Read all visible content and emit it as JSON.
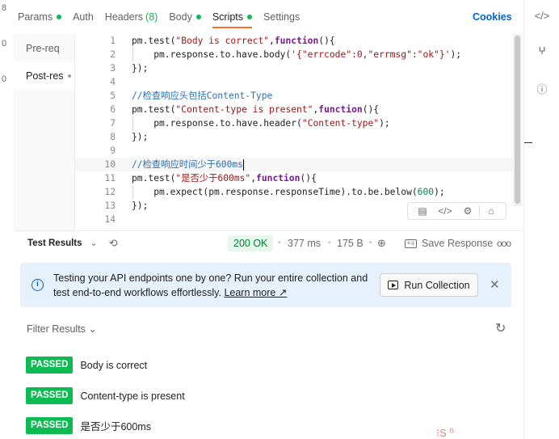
{
  "tabs": [
    {
      "label": "Params",
      "dot": true
    },
    {
      "label": "Auth"
    },
    {
      "label": "Headers",
      "count": "(8)"
    },
    {
      "label": "Body",
      "dot": true
    },
    {
      "label": "Scripts",
      "dot": true,
      "active": true
    },
    {
      "label": "Settings"
    }
  ],
  "cookies_label": "Cookies",
  "script_sidebar": [
    "Pre-req",
    "Post-res"
  ],
  "editor": {
    "lines": [
      {
        "n": "1",
        "code": "pm.test(\"Body is correct\",function(){"
      },
      {
        "n": "2",
        "code": "    pm.response.to.have.body('{\"errcode\":0,\"errmsg\":\"ok\"}');"
      },
      {
        "n": "3",
        "code": "});"
      },
      {
        "n": "4",
        "code": ""
      },
      {
        "n": "5",
        "code": "//检查响应头包括Content-Type"
      },
      {
        "n": "6",
        "code": "pm.test(\"Content-type is present\",function(){"
      },
      {
        "n": "7",
        "code": "    pm.response.to.have.header(\"Content-type\");"
      },
      {
        "n": "8",
        "code": "});"
      },
      {
        "n": "9",
        "code": ""
      },
      {
        "n": "10",
        "code": "//检查响应时间少于600ms"
      },
      {
        "n": "11",
        "code": "pm.test(\"是否少于600ms\",function(){"
      },
      {
        "n": "12",
        "code": "    pm.expect(pm.response.responseTime).to.be.below(600);"
      },
      {
        "n": "13",
        "code": "});"
      },
      {
        "n": "14",
        "code": ""
      }
    ]
  },
  "response": {
    "test_results_label": "Test Results",
    "status": "200 OK",
    "time": "377 ms",
    "size": "175 B",
    "save_label": "Save Response",
    "more": "ooo"
  },
  "banner": {
    "text": "Testing your API endpoints one by one? Run your entire collection and test end-to-end workflows effortlessly.",
    "link": "Learn more ↗",
    "button": "Run Collection"
  },
  "filter_label": "Filter Results",
  "results": [
    {
      "badge": "PASSED",
      "name": "Body is correct"
    },
    {
      "badge": "PASSED",
      "name": "Content-type is present"
    },
    {
      "badge": "PASSED",
      "name": "是否少于600ms"
    }
  ],
  "colors": {
    "accent": "#ff6c37",
    "pass": "#0cbb52",
    "link": "#0265d2",
    "banner_bg": "#e6f1fc"
  }
}
